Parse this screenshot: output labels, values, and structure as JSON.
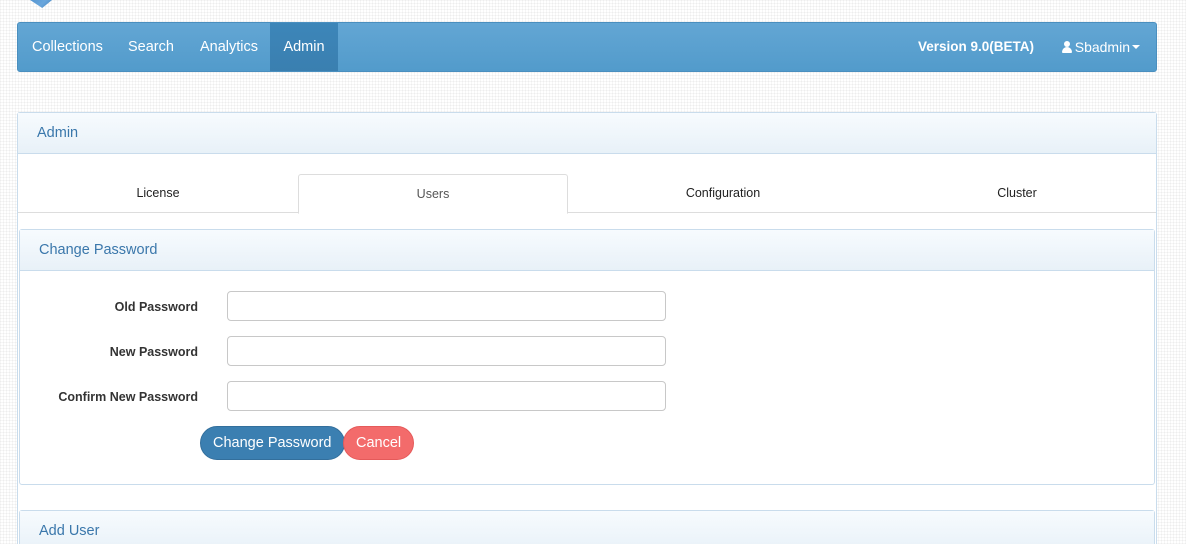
{
  "navbar": {
    "items": [
      {
        "label": "Collections"
      },
      {
        "label": "Search"
      },
      {
        "label": "Analytics"
      },
      {
        "label": "Admin"
      }
    ],
    "version": "Version 9.0(BETA)",
    "user": "Sbadmin"
  },
  "admin": {
    "title": "Admin",
    "tabs": [
      {
        "label": "License"
      },
      {
        "label": "Users"
      },
      {
        "label": "Configuration"
      },
      {
        "label": "Cluster"
      }
    ],
    "active_tab": "Users"
  },
  "change_password": {
    "title": "Change Password",
    "fields": {
      "old_label": "Old Password",
      "new_label": "New Password",
      "confirm_label": "Confirm New Password",
      "old_value": "",
      "new_value": "",
      "confirm_value": ""
    },
    "submit_label": "Change Password",
    "cancel_label": "Cancel"
  },
  "add_user": {
    "title": "Add User"
  },
  "colors": {
    "navbar": "#5aa0d0",
    "primary": "#3b7fb1",
    "danger": "#f36b6b",
    "heading_text": "#3a77ab"
  },
  "icons": {
    "user": "user-icon",
    "dropdown": "caret-down-icon"
  }
}
